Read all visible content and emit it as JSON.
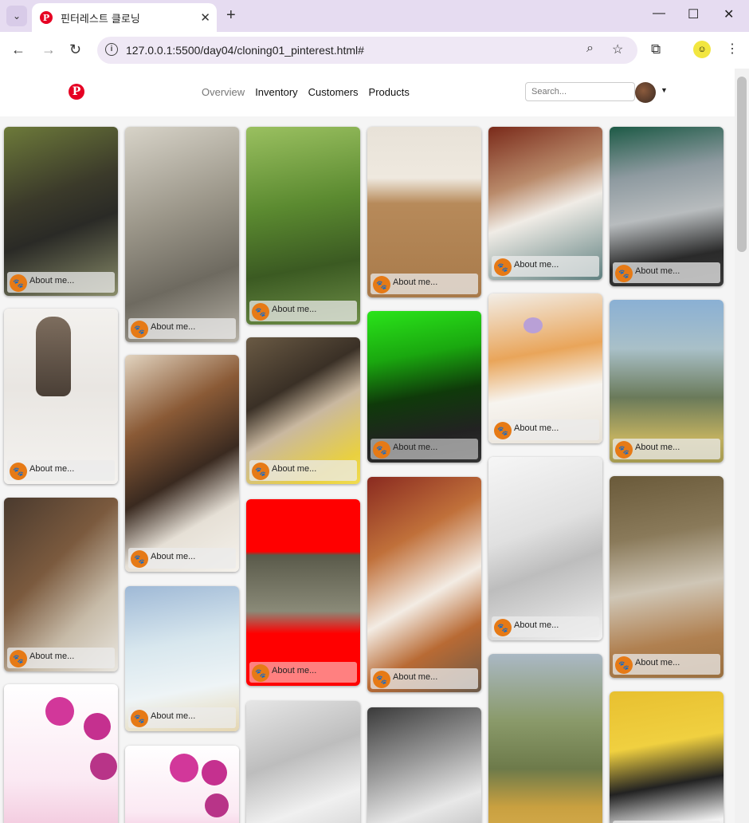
{
  "browser": {
    "tab_title": "핀터레스트 클로닝",
    "url": "127.0.0.1:5500/day04/cloning01_pinterest.html#"
  },
  "header": {
    "nav": [
      "Overview",
      "Inventory",
      "Customers",
      "Products"
    ],
    "search_placeholder": "Search..."
  },
  "pins": {
    "caption": "About me..."
  },
  "colors": {
    "brand": "#e60023",
    "paw": "#e67a16"
  }
}
